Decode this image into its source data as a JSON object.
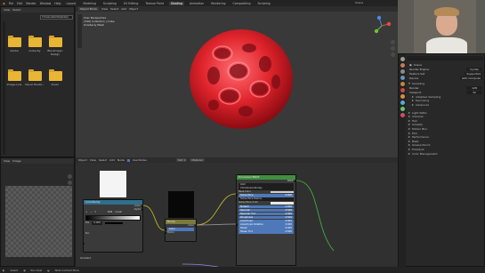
{
  "menu": {
    "items": [
      "File",
      "Edit",
      "Render",
      "Window",
      "Help"
    ],
    "workspaces": [
      "Layout",
      "Modeling",
      "Sculpting",
      "UV Editing",
      "Texture Paint",
      "Shading",
      "Animation",
      "Rendering",
      "Compositing",
      "Scripting"
    ],
    "active_workspace": "Shading",
    "scene_label": "Scene",
    "view_layer_label": "ViewLayer"
  },
  "file_browser": {
    "path": "C:\\Users\\Sam\\Desktop\\",
    "menu": [
      "View",
      "Select"
    ],
    "folders": [
      {
        "label": "Adobe"
      },
      {
        "label": "Audacity"
      },
      {
        "label": "Blackmagic Design"
      },
      {
        "label": "Image-Line"
      },
      {
        "label": "Visual Studio..."
      },
      {
        "label": "Zoom"
      }
    ]
  },
  "viewport": {
    "mode": "Object Mode",
    "menu": [
      "View",
      "Select",
      "Add",
      "Object"
    ],
    "overlay_lines": [
      "User Perspective",
      "(349) Collection | Cube",
      "Unlaberly Mesh"
    ]
  },
  "properties": {
    "scene_title": "Scene",
    "render_engine_label": "Render Engine",
    "render_engine_value": "Cycles",
    "feature_set_label": "Feature Set",
    "feature_set_value": "Supported",
    "device_label": "Device",
    "device_value": "GPU Compute",
    "sampling_label": "Sampling",
    "render_samples_label": "Render",
    "render_samples_value": "128",
    "viewport_samples_label": "Viewport",
    "viewport_samples_value": "32",
    "sampling_sub": [
      "Adaptive Sampling",
      "Denoising",
      "Advanced"
    ],
    "sections": [
      "Light Paths",
      "Volumes",
      "Hair",
      "Simplify",
      "Motion Blur",
      "Film",
      "Performance",
      "Bake",
      "Grease Pencil",
      "Freestyle",
      "Color Management"
    ]
  },
  "image_editor": {
    "header": [
      "View",
      "Image"
    ]
  },
  "node_editor": {
    "header": [
      "Object",
      "View",
      "Select",
      "Add",
      "Node"
    ],
    "use_nodes_label": "Use Nodes",
    "slot_label": "Slot 1",
    "material_label": "Material",
    "frame_label": "Gradient",
    "status_left": [
      "Select",
      "Pan View"
    ],
    "status_right": "Node Context Menu",
    "nodes": {
      "color_ramp": {
        "title": "ColorRamp",
        "outputs": [
          "Color",
          "Alpha"
        ],
        "mode": "RGB",
        "interp": "Linear",
        "pos_label": "Pos",
        "pos_value": "0.000",
        "input": "Fac"
      },
      "bump": {
        "title": "Bump",
        "outputs": [
          "Color"
        ],
        "inputs": [
          "Color",
          "Factor"
        ]
      },
      "principled": {
        "title": "Principled BSDF",
        "output": "BSDF",
        "distribution": "GGX",
        "subsurface_method": "Christensen-Burley",
        "rows": [
          {
            "label": "Base Color",
            "type": "color"
          },
          {
            "label": "Subsurface",
            "value": "0.000",
            "type": "slider"
          },
          {
            "label": "Subsurface Radius",
            "type": "field"
          },
          {
            "label": "Subsurface Color",
            "type": "field"
          },
          {
            "label": "Metallic",
            "value": "0.000",
            "type": "slider"
          },
          {
            "label": "Specular",
            "value": "0.500",
            "type": "slider"
          },
          {
            "label": "Specular Tint",
            "value": "0.000",
            "type": "slider"
          },
          {
            "label": "Roughness",
            "value": "0.500",
            "type": "slider"
          },
          {
            "label": "Anisotropic",
            "value": "0.000",
            "type": "slider"
          },
          {
            "label": "Anisotropic Rotation",
            "value": "0.000",
            "type": "slider"
          },
          {
            "label": "Sheen",
            "value": "0.000",
            "type": "slider"
          },
          {
            "label": "Sheen Tint",
            "value": "0.500",
            "type": "slider"
          }
        ]
      }
    }
  },
  "colors": {
    "accent": "#4e78b8",
    "folder": "#e9b535",
    "node_header_input": "#2f6f8c",
    "node_header_shader": "#3f8f3f",
    "node_header_vector": "#7a7a3a",
    "sphere": "#e0242c"
  }
}
